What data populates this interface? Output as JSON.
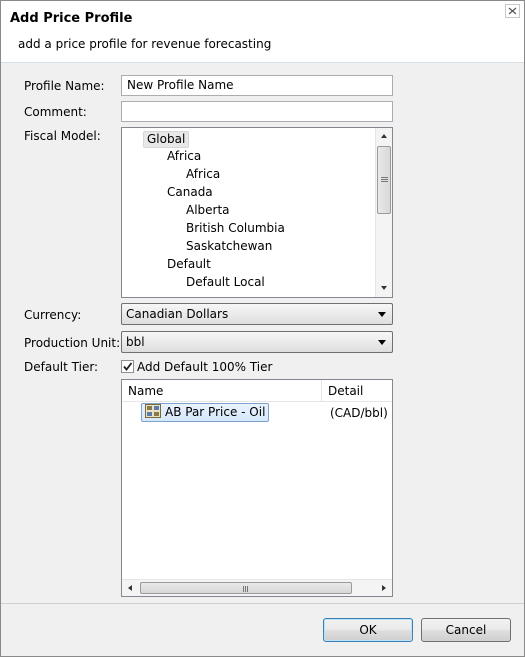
{
  "dialog": {
    "title": "Add Price Profile",
    "subtitle": "add a price profile for revenue forecasting"
  },
  "form": {
    "profile_name_label": "Profile Name:",
    "profile_name_value": "New Profile Name",
    "comment_label": "Comment:",
    "comment_value": "",
    "fiscal_model_label": "Fiscal Model:",
    "currency_label": "Currency:",
    "currency_value": "Canadian Dollars",
    "production_unit_label": "Production Unit:",
    "production_unit_value": "bbl",
    "default_tier_label": "Default Tier:",
    "default_tier_checkbox_label": "Add Default 100% Tier",
    "default_tier_checked": true
  },
  "fiscal_tree": {
    "items": [
      {
        "label": "Global",
        "level": 0,
        "selected": true
      },
      {
        "label": "Africa",
        "level": 1
      },
      {
        "label": "Africa",
        "level": 2
      },
      {
        "label": "Canada",
        "level": 1
      },
      {
        "label": "Alberta",
        "level": 2
      },
      {
        "label": "British Columbia",
        "level": 2
      },
      {
        "label": "Saskatchewan",
        "level": 2
      },
      {
        "label": "Default",
        "level": 1
      },
      {
        "label": "Default Local",
        "level": 2
      }
    ]
  },
  "tiers_table": {
    "columns": [
      "Name",
      "Detail"
    ],
    "rows": [
      {
        "name": "AB Par Price - Oil",
        "detail": "(CAD/bbl)",
        "icon": "price-profile-icon"
      }
    ]
  },
  "buttons": {
    "ok": "OK",
    "cancel": "Cancel"
  }
}
